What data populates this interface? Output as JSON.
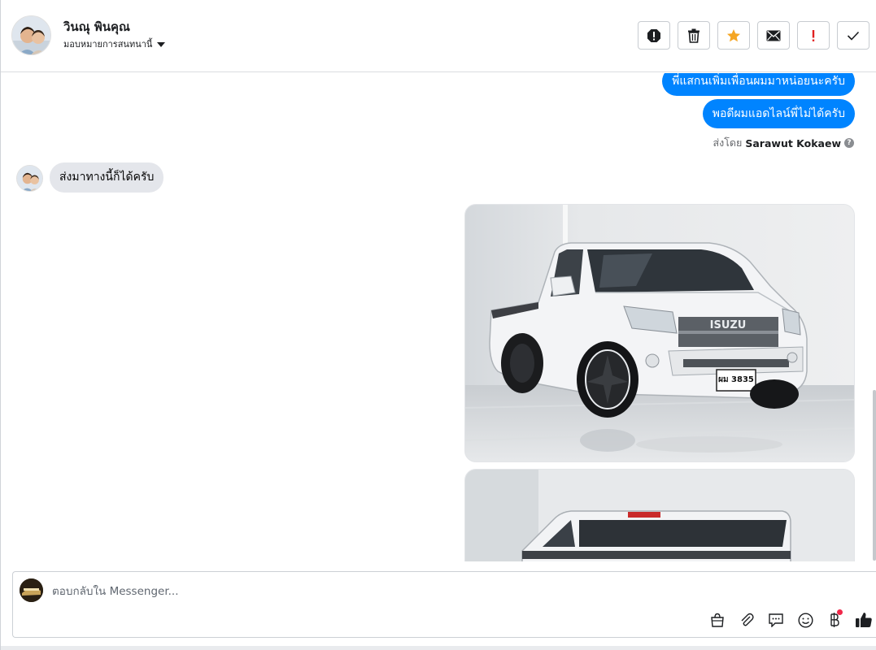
{
  "header": {
    "contact_name": "วินณุ พินคุณ",
    "assign_label": "มอบหมายการสนทนานี้"
  },
  "toolbar": {
    "buttons": [
      {
        "icon": "alert-octagon-icon",
        "tooltip": ""
      },
      {
        "icon": "trash-icon",
        "tooltip": ""
      },
      {
        "icon": "star-icon",
        "color": "#f5a623"
      },
      {
        "icon": "envelope-icon",
        "tooltip": ""
      },
      {
        "icon": "exclamation-icon",
        "color": "#e02020"
      },
      {
        "icon": "check-icon",
        "tooltip": ""
      }
    ]
  },
  "messages": {
    "out_1": "พี่แสกนเพิ่มเพื่อนผมมาหน่อยนะครับ",
    "out_2": "พอดีผมแอดไลน์พี่ไม่ได้ครับ",
    "sent_by_prefix": "ส่งโดย",
    "sent_by_name": "Sarawut Kokaew",
    "in_1": "ส่งมาทางนี้ก็ได้ครับ"
  },
  "photo": {
    "grille_text": "ISUZU",
    "plate_text": "ผม 3835"
  },
  "composer": {
    "placeholder": "ตอบกลับใน Messenger...",
    "value": ""
  },
  "colors": {
    "accent": "#0084ff",
    "incoming_bubble": "#e4e6eb"
  }
}
